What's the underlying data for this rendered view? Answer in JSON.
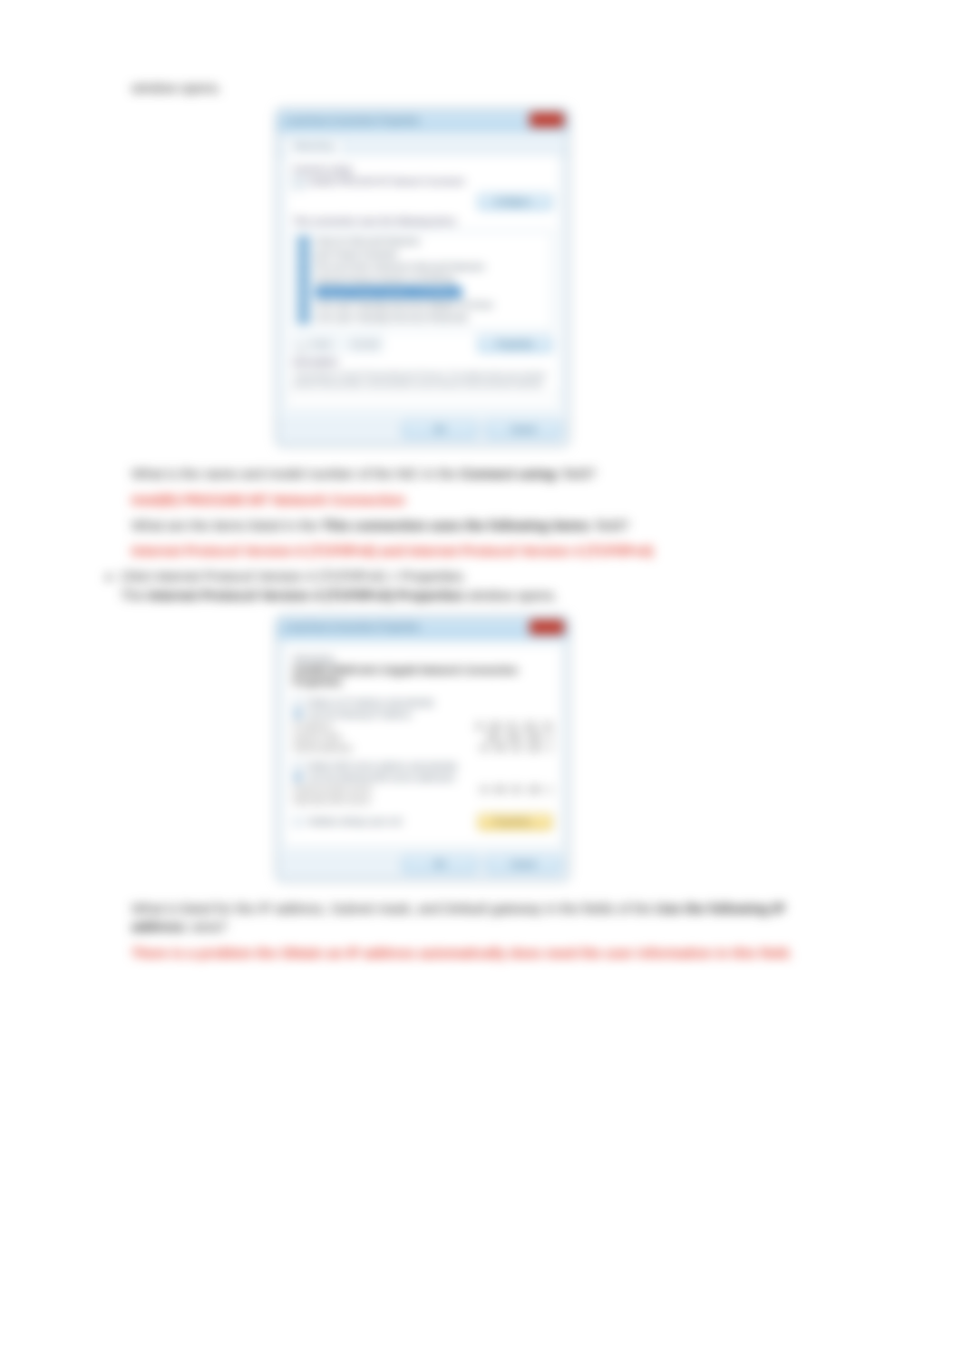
{
  "intro": {
    "tail": "window opens."
  },
  "dialog1": {
    "title": "Local Area Connection Properties",
    "tab": "Networking",
    "connect_using_label": "Connect using:",
    "adapter": "Intel(R) PRO/1000 MT Network Connection",
    "configure_btn": "Configure...",
    "items_label": "This connection uses the following items:",
    "items": [
      "Client for Microsoft Networks",
      "QoS Packet Scheduler",
      "File and Printer Sharing for Microsoft Networks",
      "Internet Protocol Version 6 (TCP/IPv6)",
      "Internet Protocol Version 4 (TCP/IPv4)",
      "Link-Layer Topology Discovery Mapper I/O Driver",
      "Link-Layer Topology Discovery Responder"
    ],
    "selected_index": 4,
    "install_btn": "Install...",
    "uninstall_btn": "Uninstall",
    "properties_btn": "Properties",
    "desc_label": "Description",
    "desc_text": "Transmission Control Protocol/Internet Protocol. The default wide area network protocol that provides communication across diverse interconnected networks.",
    "ok_btn": "OK",
    "cancel_btn": "Cancel"
  },
  "q1": {
    "prompt_a": "What is the name and model number of the NIC in the",
    "prompt_b": "Connect using:",
    "prompt_c": "field?",
    "answer": "Intel(R) PRO/1000 MT Network Connection"
  },
  "q2": {
    "prompt_a": "What are the items listed in the",
    "prompt_b": "This connection uses the following items:",
    "prompt_c": "field?",
    "answer": "Internet Protocol Version 6 (TCP/IPv6) and Internet Protocol Version 4 (TCP/IPv4)"
  },
  "step_e": {
    "marker": "e.",
    "line1": "Click Internet Protocol Version 4 (TCP/IPv4) > Properties.",
    "tail_a": "The",
    "tail_b": "Internet Protocol Version 4 (TCP/IPv4) Properties",
    "tail_c": "window opens."
  },
  "dialog2": {
    "title": "Local Area Connection Properties",
    "section": "Networking",
    "headline": "Intel(R) 82567LM-3 Gigabit Network Connection Properties",
    "block1_title": "Obtain an IP address automatically",
    "block1_alt": "Use the following IP address:",
    "rows1": [
      [
        "IP address:",
        "10 . 88 . 35 . 130 . 30"
      ],
      [
        "Subnet mask:",
        "255 . 255 . 255 . 0"
      ],
      [
        "Default gateway:",
        "10 . 88 . 35 . 130 . 1"
      ]
    ],
    "block2_title": "Obtain DNS server address automatically",
    "block2_alt": "Use the following DNS server addresses:",
    "rows2": [
      [
        "Preferred DNS server:",
        "10 . 88 . 35 . 130 . 1"
      ],
      [
        "Alternate DNS server:",
        ""
      ]
    ],
    "validate": "Validate settings upon exit",
    "properties_btn": "Properties...",
    "ok_btn": "OK",
    "cancel_btn": "Cancel"
  },
  "q3": {
    "prompt_a": "What is listed for the IP address, Subnet mask, and Default gateway in the fields of the",
    "prompt_b": "Use the following IP address:",
    "prompt_c": "area?",
    "answer": "There is a problem the Obtain an IP address automatically does need the user information in this field."
  }
}
